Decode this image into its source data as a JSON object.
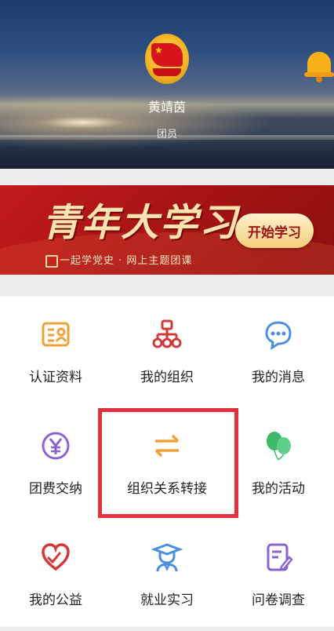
{
  "profile": {
    "name": "黄靖茵",
    "role": "团员"
  },
  "banner": {
    "title": "青年大学习",
    "subtitle": "一起学党史 · 网上主题团课",
    "button_label": "开始学习"
  },
  "menu": {
    "items": [
      {
        "label": "认证资料",
        "icon": "id-card-icon"
      },
      {
        "label": "我的组织",
        "icon": "org-chart-icon"
      },
      {
        "label": "我的消息",
        "icon": "chat-bubble-icon"
      },
      {
        "label": "团费交纳",
        "icon": "yuan-coin-icon"
      },
      {
        "label": "组织关系转接",
        "icon": "transfer-arrows-icon"
      },
      {
        "label": "我的活动",
        "icon": "balloons-icon"
      },
      {
        "label": "我的公益",
        "icon": "heart-hand-icon"
      },
      {
        "label": "就业实习",
        "icon": "graduate-icon"
      },
      {
        "label": "问卷调查",
        "icon": "survey-icon"
      }
    ]
  },
  "colors": {
    "orange": "#f0a23a",
    "red": "#d23a3a",
    "blue": "#4a8fe0",
    "purple": "#8a63d2",
    "green": "#3fb96a",
    "highlight": "#e0323c"
  }
}
